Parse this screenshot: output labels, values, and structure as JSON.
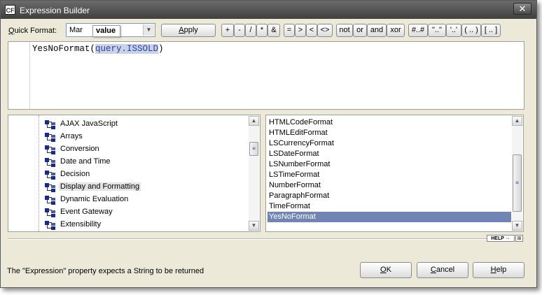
{
  "window": {
    "title": "Expression Builder",
    "close_label": "✕",
    "app_icon_text": "CF"
  },
  "quick_format": {
    "label_prefix": "",
    "label_accel": "Q",
    "label_rest": "uick Format:",
    "value": "Mar",
    "tooltip": "value",
    "apply_prefix": "",
    "apply_accel": "A",
    "apply_rest": "pply"
  },
  "operators": [
    "+",
    "-",
    "/",
    "*",
    "&",
    "=",
    ">",
    "<",
    "<>",
    "not",
    "or",
    "and",
    "xor",
    "#..#",
    "\"..\"",
    "'..'",
    "( .. )",
    "[ .. ]"
  ],
  "expression": {
    "func": "YesNoFormat",
    "open": "(",
    "arg": "query.ISSOLD",
    "close": ")"
  },
  "categories": [
    {
      "label": "AJAX JavaScript"
    },
    {
      "label": "Arrays"
    },
    {
      "label": "Conversion"
    },
    {
      "label": "Date and Time"
    },
    {
      "label": "Decision"
    },
    {
      "label": "Display and Formatting"
    },
    {
      "label": "Dynamic Evaluation"
    },
    {
      "label": "Event Gateway"
    },
    {
      "label": "Extensibility"
    }
  ],
  "selected_category": "Display and Formatting",
  "functions": [
    "HTMLCodeFormat",
    "HTMLEditFormat",
    "LSCurrencyFormat",
    "LSDateFormat",
    "LSNumberFormat",
    "LSTimeFormat",
    "NumberFormat",
    "ParagraphFormat",
    "TimeFormat",
    "YesNoFormat"
  ],
  "selected_function": "YesNoFormat",
  "help_toggle": "HELP",
  "status_text": "The \"Expression\" property expects a String to be returned",
  "buttons": {
    "ok": {
      "accel": "O",
      "rest": "K"
    },
    "cancel": {
      "accel": "C",
      "rest": "ancel"
    },
    "help": {
      "accel": "H",
      "rest": "elp"
    }
  },
  "colors": {
    "selection": "#7185b4",
    "titlebar": "#4f4f4f",
    "tree_icon": "#1a2a8a",
    "expr_selection": "#c8d3e8"
  },
  "scroll": {
    "categories_position": 0.2,
    "functions_position": 0.75
  }
}
